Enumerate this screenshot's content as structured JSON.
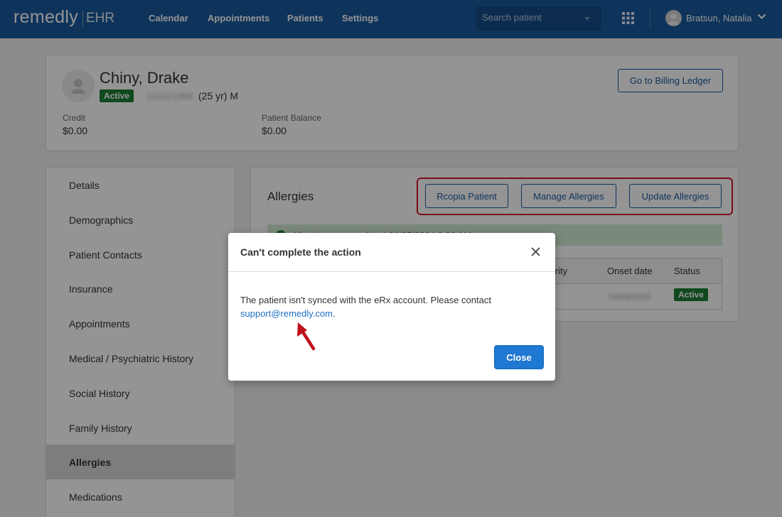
{
  "header": {
    "logo": "remedly",
    "logo_suffix": "EHR",
    "nav": [
      "Calendar",
      "Appointments",
      "Patients",
      "Settings"
    ],
    "search_placeholder": "Search patient",
    "user_name": "Bratsun, Natalia"
  },
  "patient": {
    "name": "Chiny, Drake",
    "status": "Active",
    "dob": "10/10/1998",
    "age_sex": "(25 yr) M",
    "credit_label": "Credit",
    "credit_value": "$0.00",
    "balance_label": "Patient Balance",
    "balance_value": "$0.00",
    "billing_button": "Go to Billing Ledger"
  },
  "sidebar": {
    "items": [
      {
        "label": "Details"
      },
      {
        "label": "Demographics"
      },
      {
        "label": "Patient Contacts"
      },
      {
        "label": "Insurance"
      },
      {
        "label": "Appointments"
      },
      {
        "label": "Medical / Psychiatric History"
      },
      {
        "label": "Social History"
      },
      {
        "label": "Family History"
      },
      {
        "label": "Allergies"
      },
      {
        "label": "Medications"
      }
    ],
    "active_item": "Allergies"
  },
  "allergies": {
    "title": "Allergies",
    "buttons": {
      "rcopia": "Rcopia Patient",
      "manage": "Manage Allergies",
      "update": "Update Allergies"
    },
    "alert_text": "Allergies were updated 01/05/2024 3:26 AM",
    "table": {
      "headers": {
        "severity": "Severity",
        "onset": "Onset date",
        "status": "Status"
      },
      "rows": [
        {
          "onset": "10/09/2023",
          "status": "Active"
        }
      ]
    }
  },
  "modal": {
    "title": "Can't complete the action",
    "message": "The patient isn't synced with the eRx account. Please contact",
    "link": "support@remedly.com",
    "link_suffix": ".",
    "close_button": "Close"
  },
  "colors": {
    "header_bg": "#1b5a9f",
    "primary": "#1f78d1",
    "success": "#1e7e34",
    "highlight": "#d6152a"
  }
}
